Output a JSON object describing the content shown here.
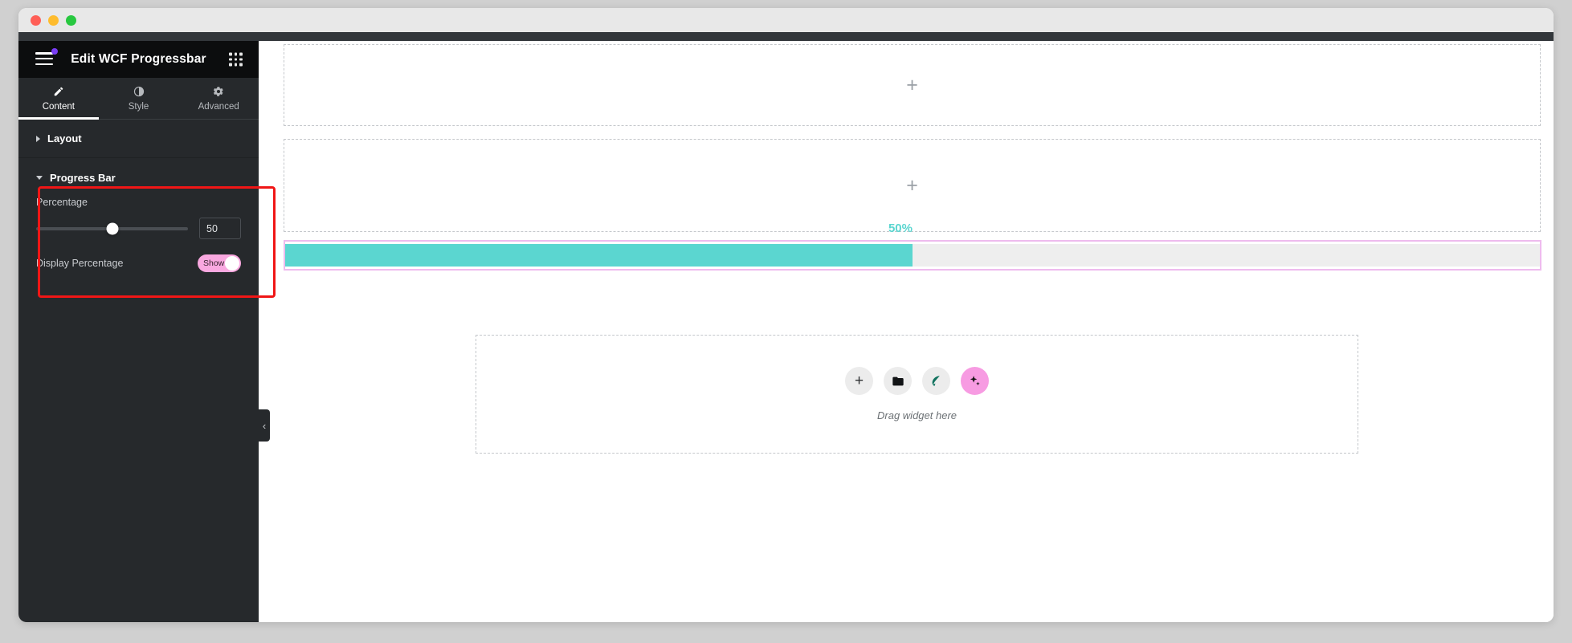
{
  "window": {
    "traffic_lights": [
      "close",
      "minimize",
      "zoom"
    ]
  },
  "panel": {
    "title": "Edit WCF Progressbar",
    "menu_icon": "hamburger-icon",
    "widgets_icon": "grid-icon",
    "collapse_icon": "‹",
    "tabs": [
      {
        "label": "Content",
        "icon": "pencil-icon",
        "active": true
      },
      {
        "label": "Style",
        "icon": "half-circle-icon",
        "active": false
      },
      {
        "label": "Advanced",
        "icon": "gear-icon",
        "active": false
      }
    ],
    "sections": [
      {
        "label": "Layout",
        "expanded": false
      },
      {
        "label": "Progress Bar",
        "expanded": true
      }
    ],
    "controls": {
      "percentage_label": "Percentage",
      "percentage_value": "50",
      "slider_min": "0",
      "slider_max": "100",
      "display_percentage_label": "Display Percentage",
      "display_percentage_state": "Show"
    }
  },
  "canvas": {
    "add_section_glyph": "+",
    "sections": [
      {
        "name": "empty-section-1"
      },
      {
        "name": "empty-section-2"
      }
    ],
    "progressbar": {
      "percent_text": "50%",
      "percent_value": 50,
      "fill_color": "#5bd6d0",
      "track_color": "#eeeeee",
      "selection_color": "#eebbee"
    },
    "drop_zone": {
      "text": "Drag widget here",
      "buttons": [
        {
          "icon": "plus-icon",
          "name": "add-widget-button"
        },
        {
          "icon": "folder-icon",
          "name": "add-template-button"
        },
        {
          "icon": "leaf-icon",
          "name": "third-party-widget-button"
        },
        {
          "icon": "sparkle-icon",
          "name": "ai-button"
        }
      ]
    }
  },
  "colors": {
    "panel_bg": "#26292c",
    "panel_header_bg": "#0c0d0e",
    "accent_teal": "#5bd6d0",
    "accent_pink": "#f9a8e0",
    "highlight_red": "#f01616",
    "notification_purple": "#7a3df5"
  }
}
